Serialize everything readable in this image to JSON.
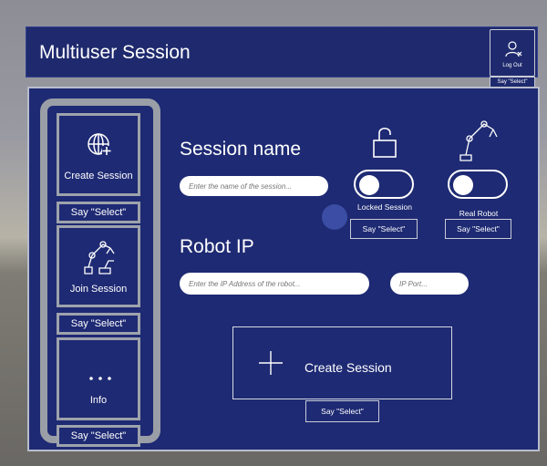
{
  "window": {
    "title": "Multiuser Session"
  },
  "logout": {
    "label": "Log Out",
    "say": "Say \"Select\""
  },
  "sidebar": {
    "items": [
      {
        "label": "Create Session",
        "icon": "globe-plus-icon",
        "say": "Say \"Select\""
      },
      {
        "label": "Join Session",
        "icon": "robot-arm-icon",
        "say": "Say \"Select\""
      },
      {
        "label": "Info",
        "icon": "more-dots-icon",
        "say": "Say \"Select\""
      }
    ]
  },
  "session": {
    "heading": "Session name",
    "name_placeholder": "Enter the name of the session..."
  },
  "toggles": {
    "locked": {
      "label": "Locked Session",
      "say": "Say \"Select\"",
      "icon": "unlock-icon",
      "on": false
    },
    "real_robot": {
      "label": "Real Robot",
      "say": "Say \"Select\"",
      "icon": "robot-arm-icon",
      "on": false
    }
  },
  "robot": {
    "heading": "Robot IP",
    "ip_placeholder": "Enter the IP Address of the robot...",
    "port_placeholder": "IP Port..."
  },
  "create": {
    "label": "Create Session",
    "icon": "plus-icon",
    "say": "Say \"Select\""
  },
  "colors": {
    "panel": "#1e2a73",
    "border": "#9ea3ac",
    "text": "#ffffff"
  }
}
